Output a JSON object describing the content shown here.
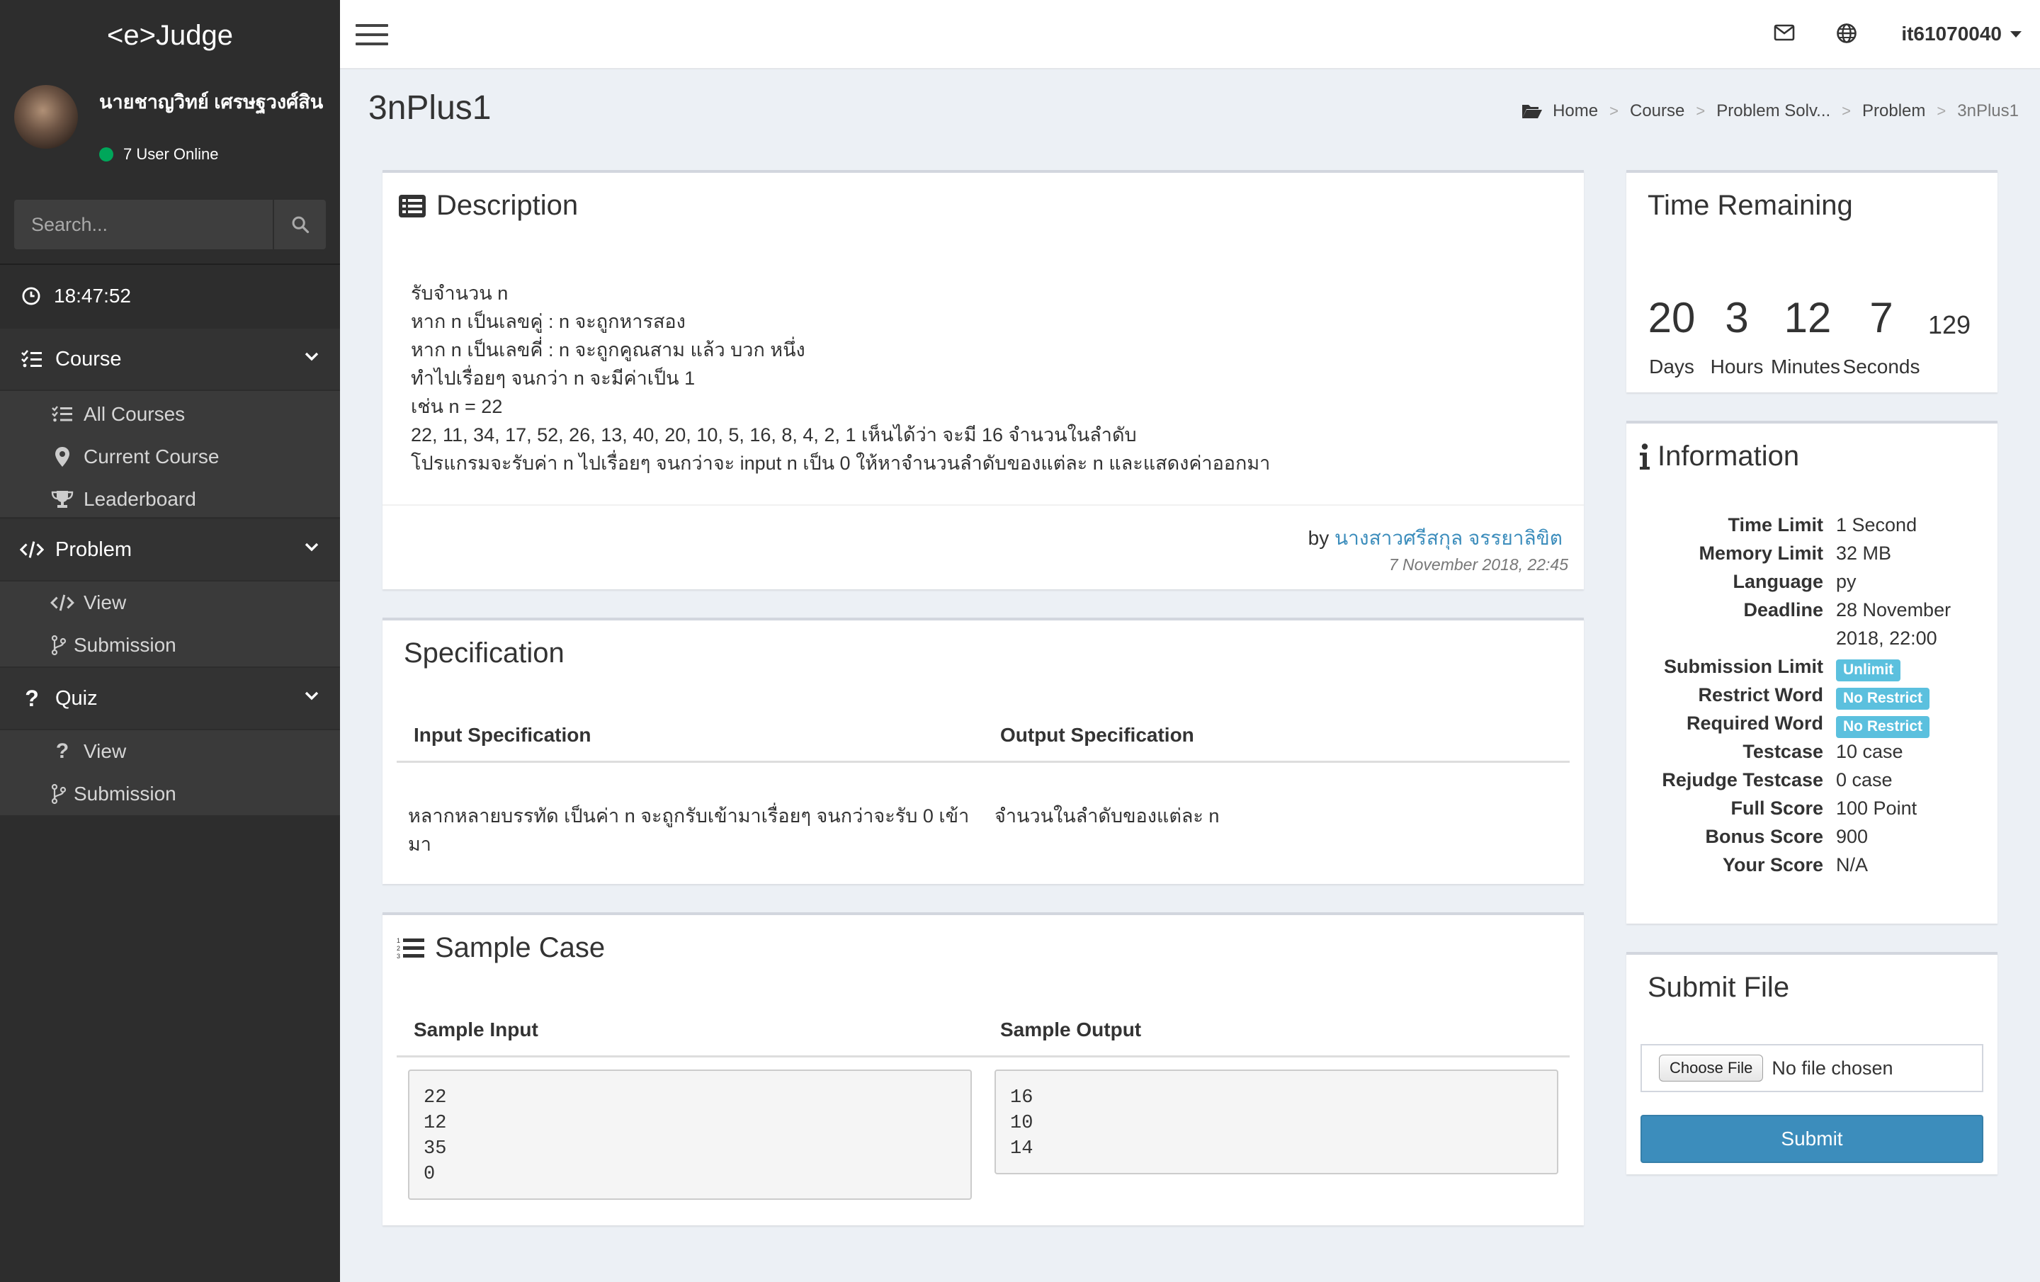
{
  "app": {
    "logo": "<e>Judge"
  },
  "user_panel": {
    "name": "นายชาญวิทย์ เศรษฐวงศ์สิน",
    "online_text": "7 User Online"
  },
  "search": {
    "placeholder": "Search..."
  },
  "clock": "18:47:52",
  "sidebar": {
    "course": {
      "label": "Course",
      "items": [
        "All Courses",
        "Current Course",
        "Leaderboard"
      ]
    },
    "problem": {
      "label": "Problem",
      "items": [
        "View",
        "Submission"
      ]
    },
    "quiz": {
      "label": "Quiz",
      "items": [
        "View",
        "Submission"
      ]
    }
  },
  "topbar": {
    "username": "it61070040"
  },
  "page": {
    "title": "3nPlus1"
  },
  "breadcrumb": [
    "Home",
    "Course",
    "Problem Solv...",
    "Problem",
    "3nPlus1"
  ],
  "description": {
    "title": "Description",
    "lines": [
      "รับจำนวน n",
      "หาก n เป็นเลขคู่ : n จะถูกหารสอง",
      "หาก n เป็นเลขคี่ : n จะถูกคูณสาม แล้ว บวก หนึ่ง",
      "ทำไปเรื่อยๆ จนกว่า n จะมีค่าเป็น 1",
      "เช่น n = 22",
      "22, 11, 34, 17, 52, 26, 13, 40, 20, 10, 5, 16, 8, 4, 2, 1 เห็นได้ว่า จะมี 16 จำนวนในลำดับ",
      "โปรแกรมจะรับค่า n ไปเรื่อยๆ จนกว่าจะ input n เป็น 0 ให้หาจำนวนลำดับของแต่ละ n และแสดงค่าออกมา"
    ],
    "by_label": "by",
    "author": "นางสาวศรีสกุล จรรยาลิขิต",
    "date": "7 November 2018, 22:45"
  },
  "specification": {
    "title": "Specification",
    "input_header": "Input Specification",
    "output_header": "Output Specification",
    "input_line1": "หลากหลายบรรทัด เป็นค่า n จะถูกรับเข้ามาเรื่อยๆ จนกว่าจะรับ 0 เข้า",
    "input_line2": "มา",
    "output_text": "จำนวนในลำดับของแต่ละ n"
  },
  "sample_case": {
    "title": "Sample Case",
    "input_header": "Sample Input",
    "output_header": "Sample Output",
    "input": "22\n12\n35\n0",
    "output": "16\n10\n14"
  },
  "time_remaining": {
    "title": "Time Remaining",
    "days": "20",
    "hours": "3",
    "minutes": "12",
    "seconds": "7",
    "extra": "129",
    "days_label": "Days",
    "hours_label": "Hours",
    "minutes_label": "Minutes",
    "seconds_label": "Seconds"
  },
  "information": {
    "title": "Information",
    "rows": [
      {
        "key": "Time Limit",
        "value": "1 Second"
      },
      {
        "key": "Memory Limit",
        "value": "32 MB"
      },
      {
        "key": "Language",
        "value": "py"
      },
      {
        "key": "Deadline",
        "value": "28 November",
        "value2": "2018, 22:00"
      },
      {
        "key": "Submission Limit",
        "badge": "Unlimit"
      },
      {
        "key": "Restrict Word",
        "badge": "No Restrict"
      },
      {
        "key": "Required Word",
        "badge": "No Restrict"
      },
      {
        "key": "Testcase",
        "value": "10 case"
      },
      {
        "key": "Rejudge Testcase",
        "value": "0 case"
      },
      {
        "key": "Full Score",
        "value": "100 Point"
      },
      {
        "key": "Bonus Score",
        "value": "900"
      },
      {
        "key": "Your Score",
        "value": "N/A"
      }
    ]
  },
  "submit_file": {
    "title": "Submit File",
    "choose_label": "Choose File",
    "no_file": "No file chosen",
    "submit_label": "Submit"
  },
  "colors": {
    "sidebar_bg": "#2d2d2d",
    "accent": "#3c8dbc",
    "badge": "#5bc0de",
    "online": "#00a65a"
  }
}
